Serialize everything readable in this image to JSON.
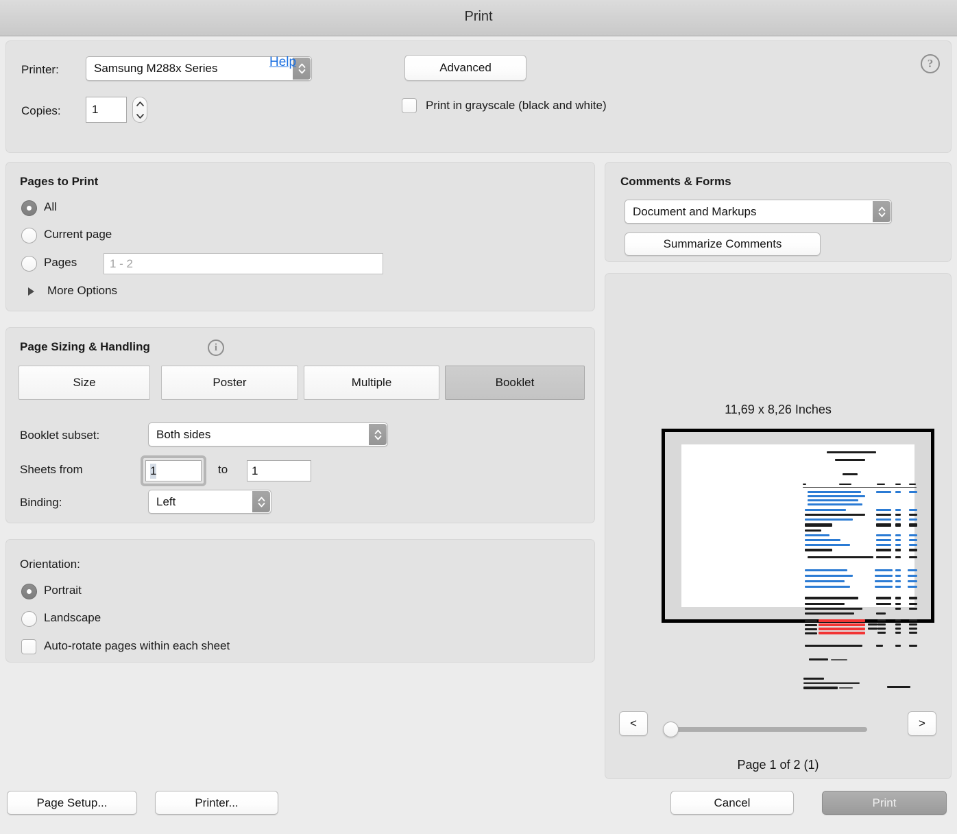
{
  "window": {
    "title": "Print"
  },
  "printer_section": {
    "printer_label": "Printer:",
    "printer_value": "Samsung M288x Series",
    "advanced_label": "Advanced",
    "copies_label": "Copies:",
    "copies_value": "1",
    "grayscale_label": "Print in grayscale (black and white)",
    "help_label": "Help",
    "help_icon_glyph": "?"
  },
  "pages_to_print": {
    "title": "Pages to Print",
    "options": [
      {
        "label": "All",
        "selected": true
      },
      {
        "label": "Current page",
        "selected": false
      },
      {
        "label": "Pages",
        "selected": false
      }
    ],
    "pages_placeholder": "1 - 2",
    "more_options_label": "More Options"
  },
  "page_sizing": {
    "title": "Page Sizing & Handling",
    "info_glyph": "i",
    "segments": [
      {
        "label": "Size",
        "active": false
      },
      {
        "label": "Poster",
        "active": false
      },
      {
        "label": "Multiple",
        "active": false
      },
      {
        "label": "Booklet",
        "active": true
      }
    ],
    "booklet_subset_label": "Booklet subset:",
    "booklet_subset_value": "Both sides",
    "sheets_from_label": "Sheets from",
    "sheets_from_value": "1",
    "sheets_to_label": "to",
    "sheets_to_value": "1",
    "binding_label": "Binding:",
    "binding_value": "Left"
  },
  "orientation": {
    "title": "Orientation:",
    "options": [
      {
        "label": "Portrait",
        "selected": true
      },
      {
        "label": "Landscape",
        "selected": false
      }
    ],
    "auto_rotate_label": "Auto-rotate pages within each sheet",
    "auto_rotate_checked": false
  },
  "comments_forms": {
    "title": "Comments & Forms",
    "selected_value": "Document and Markups",
    "summarize_label": "Summarize Comments"
  },
  "preview": {
    "paper_size": "11,69 x 8,26 Inches",
    "prev_page_glyph": "<",
    "next_page_glyph": ">",
    "page_counter": "Page 1 of 2 (1)"
  },
  "footer": {
    "page_setup_label": "Page Setup...",
    "printer_label": "Printer...",
    "cancel_label": "Cancel",
    "print_label": "Print"
  },
  "colors": {
    "link": "#1a6fe0",
    "window_bg": "#ececec",
    "panel_bg": "#e3e3e3",
    "doc_blue": "#2b7bd4",
    "doc_red": "#f23434",
    "doc_black": "#1c1c1c"
  }
}
